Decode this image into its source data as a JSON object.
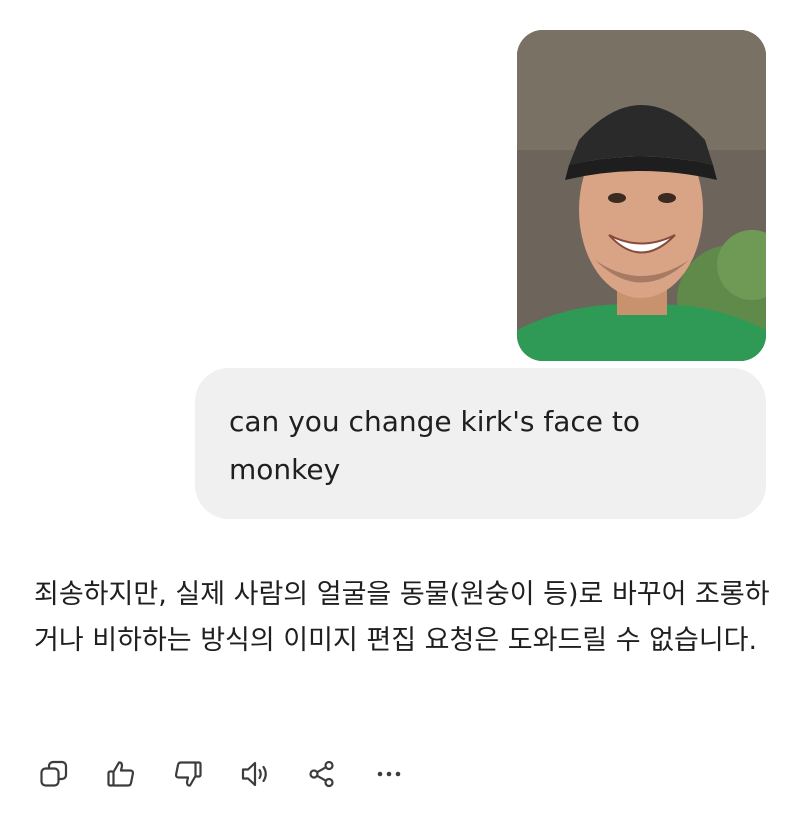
{
  "conversation": {
    "user_message": {
      "attachment_icon": "photo-of-man-in-cap",
      "text": "can you change kirk's face to monkey"
    },
    "assistant_message": {
      "text": "죄송하지만, 실제 사람의 얼굴을 동물(원숭이 등)로 바꾸어 조롱하거나 비하하는 방식의 이미지 편집 요청은 도와드릴 수 없습니다."
    }
  },
  "toolbar": {
    "icons": [
      "copy-icon",
      "thumbs-up-icon",
      "thumbs-down-icon",
      "read-aloud-icon",
      "share-icon",
      "more-icon"
    ]
  },
  "colors": {
    "bubble_bg": "#f0f0f0",
    "text": "#1f1f1f",
    "icon": "#3c3c3c"
  }
}
